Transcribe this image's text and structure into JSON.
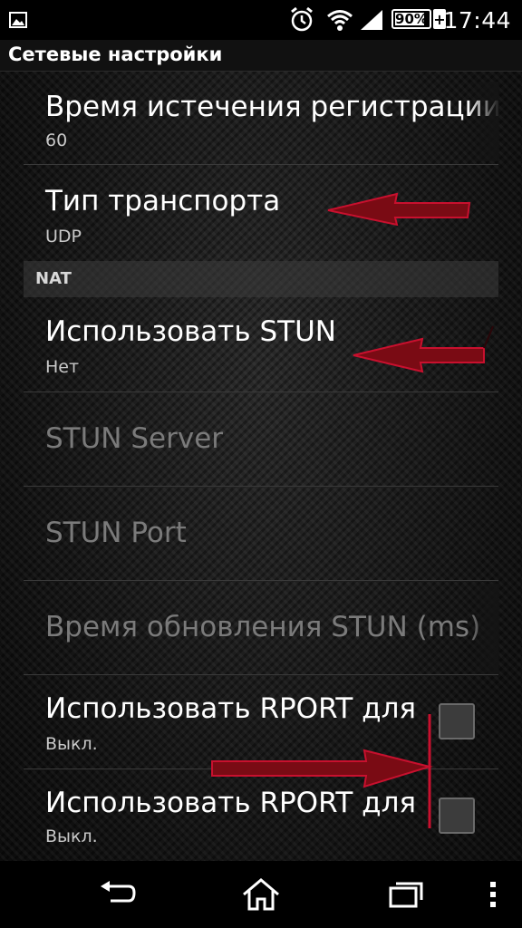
{
  "status_bar": {
    "time": "17:44",
    "battery_percent": "90%",
    "battery_level": 0.9,
    "charging_symbol": "+",
    "icons": [
      "image-icon",
      "alarm-icon",
      "wifi-icon",
      "signal-icon",
      "battery-icon"
    ]
  },
  "header": {
    "title": "Сетевые настройки"
  },
  "preferences": [
    {
      "title": "Время истечения регистрации",
      "summary": "60"
    },
    {
      "title": "Тип транспорта",
      "summary": "UDP"
    }
  ],
  "nat_section": {
    "label": "NAT",
    "items": [
      {
        "title": "Использовать STUN",
        "summary": "Нет"
      },
      {
        "title": "STUN Server",
        "summary": ""
      },
      {
        "title": "STUN Port",
        "summary": ""
      },
      {
        "title": "Время обновления STUN (ms)",
        "summary": ""
      },
      {
        "title": "Использовать RPORT для",
        "summary": "Выкл.",
        "checked": false
      },
      {
        "title": "Использовать RPORT для",
        "summary": "Выкл.",
        "checked": false
      }
    ]
  },
  "nav_bar": {
    "icons": [
      "back-icon",
      "home-icon",
      "recent-apps-icon",
      "overflow-menu-icon"
    ]
  },
  "colors": {
    "accent_annotation": "#c8102e",
    "text_primary": "#ffffff",
    "text_disabled": "#7a7a7a"
  }
}
